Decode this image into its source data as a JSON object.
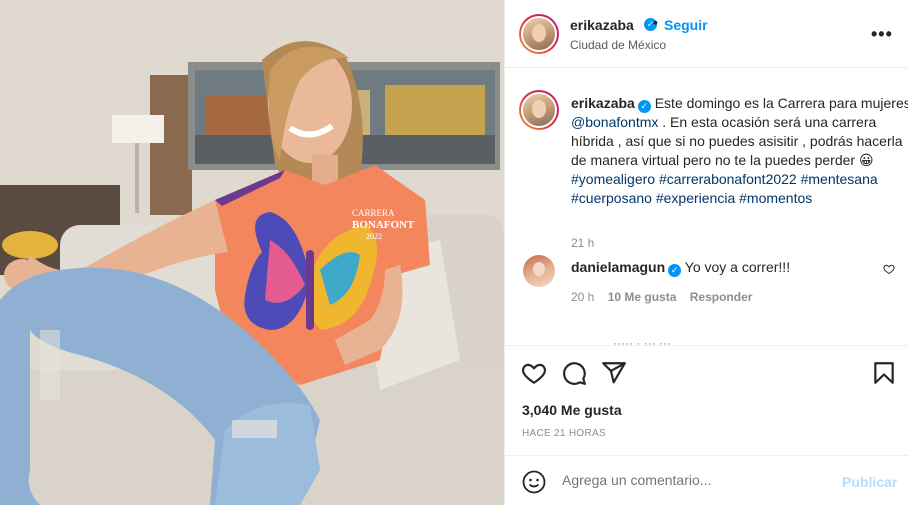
{
  "post": {
    "username": "erikazaba",
    "follow_label": "Seguir",
    "location": "Ciudad de México",
    "more_label": "•••"
  },
  "caption": {
    "username": "erikazaba",
    "text_1": "Este domingo es la Carrera para mujeres ",
    "mention": "@bonafontmx",
    "text_2": " . En esta ocasión será una carrera híbrida , así que si no puedes asisitir , podrás hacerla de manera virtual pero no te la puedes perder ",
    "emoji": "😀",
    "hashtags_1": "#yomealigero #carrerabonafont2022",
    "hashtags_2": "#mentesana #cuerposano #experiencia #momentos",
    "time": "21 h"
  },
  "comment": {
    "username": "danielamagun",
    "text": "Yo voy a correr!!!",
    "time": "20 h",
    "likes": "10 Me gusta",
    "reply_label": "Responder"
  },
  "footer": {
    "likes": "3,040 Me gusta",
    "date": "HACE 21 HORAS",
    "comment_placeholder": "Agrega un comentario...",
    "publish_label": "Publicar"
  },
  "photo": {
    "shirt_line_1": "CARRERA",
    "shirt_line_2": "BONAFONT",
    "shirt_line_3": "2022"
  },
  "colors": {
    "accent_blue": "#0095f6",
    "link_blue": "#00376b",
    "shirt_orange": "#f4865e",
    "jeans_blue": "#8fb0d2"
  },
  "icons": [
    "heart-icon",
    "comment-icon",
    "share-icon",
    "bookmark-icon",
    "emoji-icon",
    "more-icon",
    "verified-icon"
  ]
}
